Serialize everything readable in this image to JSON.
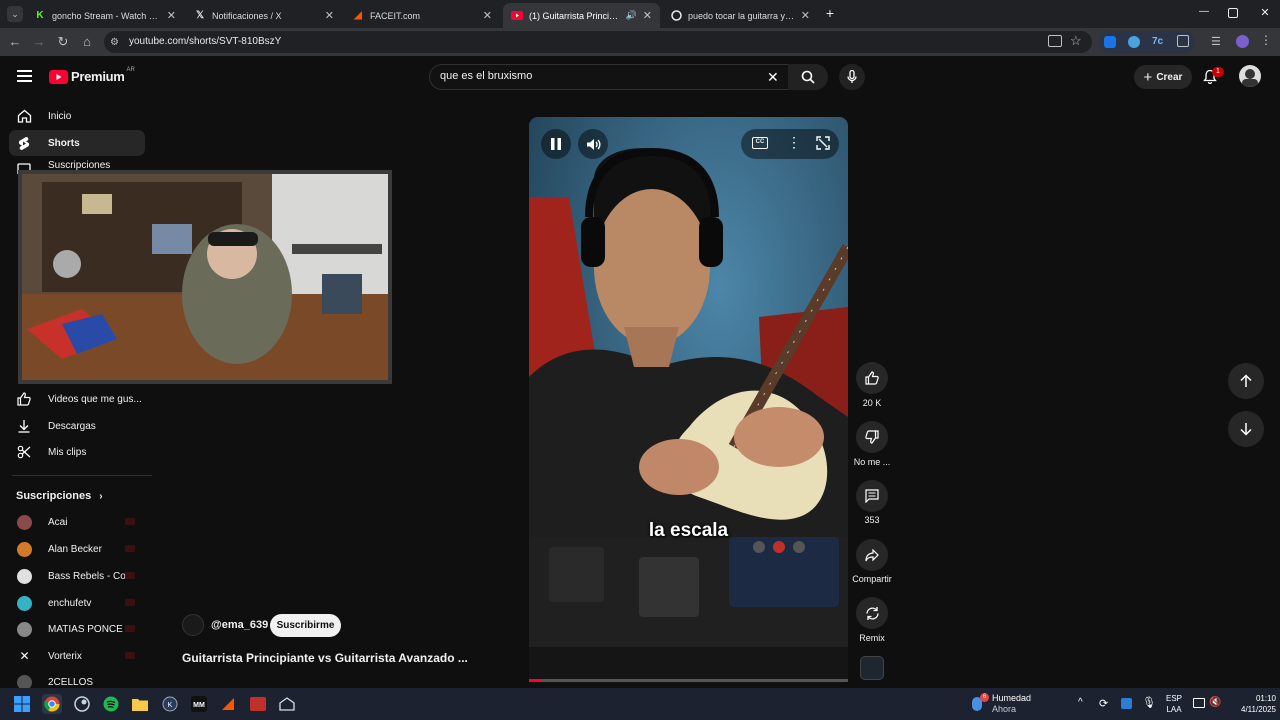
{
  "browser": {
    "tabs": [
      {
        "label": "goncho Stream - Watch Live on",
        "favicon": "kick-icon"
      },
      {
        "label": "Notificaciones / X",
        "favicon": "x-icon"
      },
      {
        "label": "FACEIT.com",
        "favicon": "faceit-icon"
      },
      {
        "label": "(1) Guitarrista Principiante v",
        "favicon": "youtube-icon"
      },
      {
        "label": "puedo tocar la guitarra y apren",
        "favicon": "google-icon"
      }
    ],
    "url": "youtube.com/shorts/SVT-810BszY"
  },
  "youtube": {
    "logo": "Premium",
    "region": "AR",
    "search_value": "que es el bruxismo",
    "create_label": "Crear",
    "notif_count": "1"
  },
  "sidebar": {
    "items": [
      {
        "label": "Inicio"
      },
      {
        "label": "Shorts"
      },
      {
        "label": "Suscripciones"
      }
    ],
    "items2": [
      {
        "label": "Videos que me gus..."
      },
      {
        "label": "Descargas"
      },
      {
        "label": "Mis clips"
      }
    ],
    "subs_title": "Suscripciones",
    "channels": [
      {
        "name": "Acai",
        "color": "#8a4a4a"
      },
      {
        "name": "Alan Becker",
        "color": "#d27a2a"
      },
      {
        "name": "Bass Rebels - Co...",
        "color": "#e0e0e0"
      },
      {
        "name": "enchufetv",
        "color": "#35b3c6"
      },
      {
        "name": "MATIAS PONCE",
        "color": "#888"
      },
      {
        "name": "Vorterix",
        "color": "#111"
      },
      {
        "name": "2CELLOS",
        "color": "#555"
      }
    ]
  },
  "short": {
    "caption": "la escala",
    "channel": "@ema_639",
    "subscribe": "Suscribirme",
    "title": "Guitarrista Principiante vs Guitarrista Avanzado ...",
    "likes": "20 K",
    "dislike": "No me ...",
    "comments": "353",
    "share": "Compartir",
    "remix": "Remix",
    "progress": 0.04
  },
  "taskbar": {
    "weather_title": "Humedad",
    "weather_sub": "Ahora",
    "weather_badge": "6",
    "lang1": "ESP",
    "lang2": "LAA",
    "time": "01:10",
    "date": "4/11/2025"
  },
  "colors": {
    "accent": "#ff0033",
    "bg": "#0f0f0f"
  }
}
